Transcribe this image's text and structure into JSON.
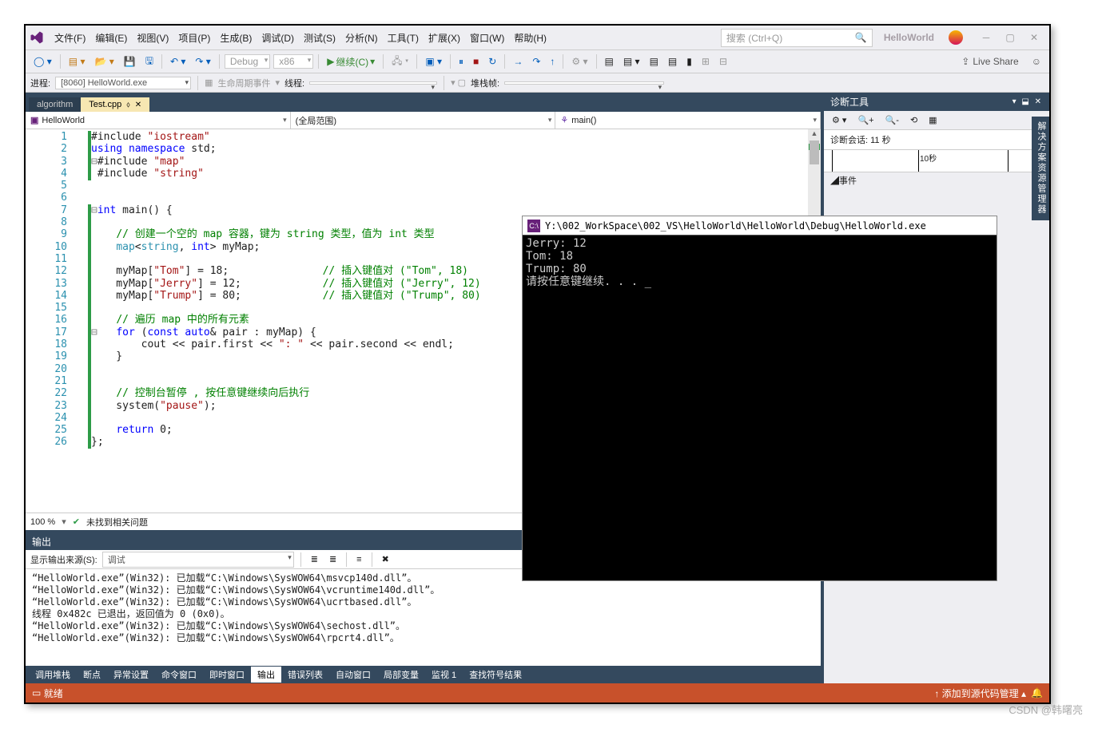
{
  "menu": {
    "items": [
      "文件(F)",
      "编辑(E)",
      "视图(V)",
      "项目(P)",
      "生成(B)",
      "调试(D)",
      "测试(S)",
      "分析(N)",
      "工具(T)",
      "扩展(X)",
      "窗口(W)",
      "帮助(H)"
    ]
  },
  "search": {
    "placeholder": "搜索 (Ctrl+Q)"
  },
  "solution_name": "HelloWorld",
  "toolbar": {
    "config": "Debug",
    "platform": "x86",
    "continue": "继续(C)",
    "live_share": "Live Share"
  },
  "processbar": {
    "label": "进程:",
    "process": "[8060] HelloWorld.exe",
    "lifecycle_label": "生命周期事件",
    "thread_label": "线程:",
    "stack_label": "堆栈帧:"
  },
  "tabs": [
    {
      "label": "algorithm",
      "active": false
    },
    {
      "label": "Test.cpp",
      "active": true
    }
  ],
  "navbar": {
    "project": "HelloWorld",
    "scope": "(全局范围)",
    "member": "main()"
  },
  "code_lines": [
    "#include <span class='str'>\"iostream\"</span>",
    "<span class='kw'>using</span> <span class='kw'>namespace</span> std;",
    "<span class='pp'>⊟</span>#include <span class='str'>\"map\"</span>",
    " #include <span class='str'>\"string\"</span>",
    "",
    "",
    "<span class='pp'>⊟</span><span class='kw'>int</span> main() {",
    "",
    "    <span class='cm'>// 创建一个空的 map 容器，键为 string 类型，值为 int 类型</span>",
    "    <span class='typ'>map</span>&lt;<span class='typ'>string</span>, <span class='kw'>int</span>&gt; myMap;",
    "",
    "    myMap[<span class='str'>\"Tom\"</span>] = 18;               <span class='cm'>// 插入键值对 (\"Tom\", 18)</span>",
    "    myMap[<span class='str'>\"Jerry\"</span>] = 12;             <span class='cm'>// 插入键值对 (\"Jerry\", 12)</span>",
    "    myMap[<span class='str'>\"Trump\"</span>] = 80;             <span class='cm'>// 插入键值对 (\"Trump\", 80)</span>",
    "",
    "    <span class='cm'>// 遍历 map 中的所有元素</span>",
    "<span class='pp'>⊟</span>   <span class='kw'>for</span> (<span class='kw'>const</span> <span class='kw'>auto</span>&amp; pair : myMap) {",
    "        cout &lt;&lt; pair.first &lt;&lt; <span class='str'>\": \"</span> &lt;&lt; pair.second &lt;&lt; endl;",
    "    }",
    "",
    "",
    "    <span class='cm'>// 控制台暂停 , 按任意键继续向后执行</span>",
    "    system(<span class='str'>\"pause\"</span>);",
    "",
    "    <span class='kw'>return</span> 0;",
    "};"
  ],
  "zoom": {
    "pct": "100 %",
    "msg": "未找到相关问题"
  },
  "output": {
    "title": "输出",
    "src_label": "显示输出来源(S):",
    "src_value": "调试",
    "lines": [
      "“HelloWorld.exe”(Win32): 已加载“C:\\Windows\\SysWOW64\\msvcp140d.dll”。",
      "“HelloWorld.exe”(Win32): 已加载“C:\\Windows\\SysWOW64\\vcruntime140d.dll”。",
      "“HelloWorld.exe”(Win32): 已加载“C:\\Windows\\SysWOW64\\ucrtbased.dll”。",
      "线程 0x482c 已退出，返回值为 0 (0x0)。",
      "“HelloWorld.exe”(Win32): 已加载“C:\\Windows\\SysWOW64\\sechost.dll”。",
      "“HelloWorld.exe”(Win32): 已加载“C:\\Windows\\SysWOW64\\rpcrt4.dll”。"
    ]
  },
  "bottom_tabs": [
    "调用堆栈",
    "断点",
    "异常设置",
    "命令窗口",
    "即时窗口",
    "输出",
    "错误列表",
    "自动窗口",
    "局部变量",
    "监视 1",
    "查找符号结果"
  ],
  "bottom_active": 5,
  "status": {
    "left": "就绪",
    "right": "添加到源代码管理"
  },
  "diag": {
    "title": "诊断工具",
    "session": "诊断会话: 11 秒",
    "timeline_label": "10秒",
    "events": "◢事件"
  },
  "right_tab": "解决方案资源管理器",
  "console": {
    "title": "Y:\\002_WorkSpace\\002_VS\\HelloWorld\\HelloWorld\\Debug\\HelloWorld.exe",
    "body": "Jerry: 12\nTom: 18\nTrump: 80\n请按任意键继续. . . _"
  },
  "watermark": "CSDN @韩曙亮"
}
